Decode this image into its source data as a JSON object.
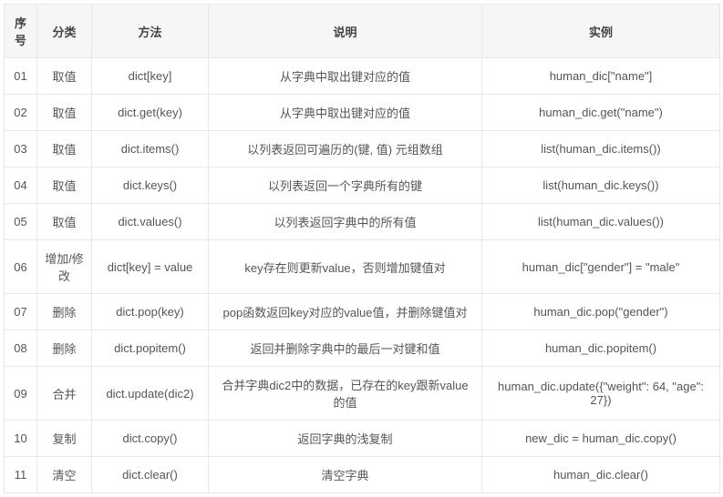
{
  "headers": {
    "seq": "序号",
    "category": "分类",
    "method": "方法",
    "description": "说明",
    "example": "实例"
  },
  "rows": [
    {
      "seq": "01",
      "category": "取值",
      "method": "dict[key]",
      "description": "从字典中取出键对应的值",
      "example": "human_dic[\"name\"]"
    },
    {
      "seq": "02",
      "category": "取值",
      "method": "dict.get(key)",
      "description": "从字典中取出键对应的值",
      "example": "human_dic.get(\"name\")"
    },
    {
      "seq": "03",
      "category": "取值",
      "method": "dict.items()",
      "description": "以列表返回可遍历的(键, 值) 元组数组",
      "example": "list(human_dic.items())"
    },
    {
      "seq": "04",
      "category": "取值",
      "method": "dict.keys()",
      "description": "以列表返回一个字典所有的键",
      "example": "list(human_dic.keys())"
    },
    {
      "seq": "05",
      "category": "取值",
      "method": "dict.values()",
      "description": "以列表返回字典中的所有值",
      "example": "list(human_dic.values())"
    },
    {
      "seq": "06",
      "category": "增加/修改",
      "method": "dict[key] = value",
      "description": "key存在则更新value，否则增加键值对",
      "example": "human_dic[\"gender\"] = \"male\""
    },
    {
      "seq": "07",
      "category": "删除",
      "method": "dict.pop(key)",
      "description": "pop函数返回key对应的value值，并删除键值对",
      "example": "human_dic.pop(\"gender\")"
    },
    {
      "seq": "08",
      "category": "删除",
      "method": "dict.popitem()",
      "description": "返回并删除字典中的最后一对键和值",
      "example": "human_dic.popitem()"
    },
    {
      "seq": "09",
      "category": "合并",
      "method": "dict.update(dic2)",
      "description": "合并字典dic2中的数据，已存在的key跟新value的值",
      "example": "human_dic.update({\"weight\": 64, \"age\": 27})"
    },
    {
      "seq": "10",
      "category": "复制",
      "method": "dict.copy()",
      "description": "返回字典的浅复制",
      "example": "new_dic = human_dic.copy()"
    },
    {
      "seq": "11",
      "category": "清空",
      "method": "dict.clear()",
      "description": "清空字典",
      "example": "human_dic.clear()"
    }
  ]
}
